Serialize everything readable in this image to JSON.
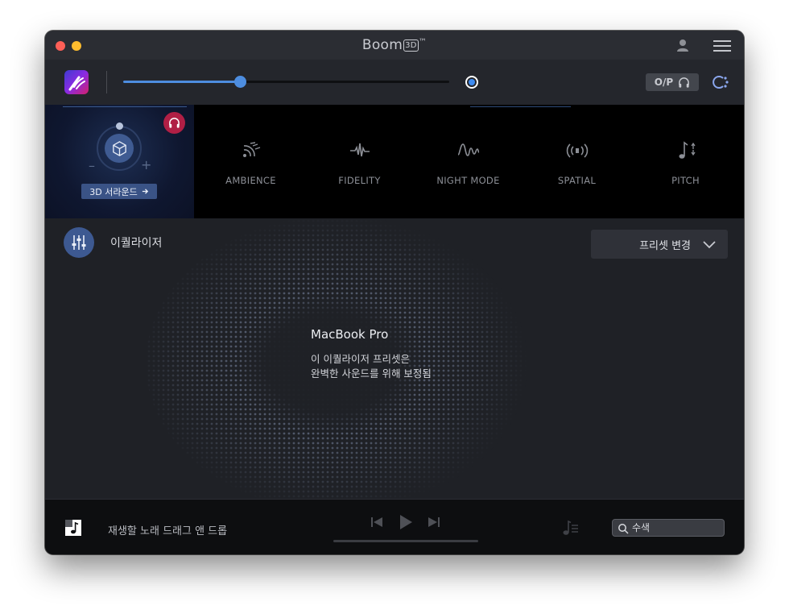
{
  "window": {
    "title": "Boom",
    "title_badge": "3D",
    "title_tm": "™"
  },
  "volume": {
    "level_fraction": 0.358,
    "op_label": "O/P"
  },
  "surround": {
    "button_label": "3D 서라운드",
    "minus": "–",
    "plus": "+"
  },
  "effects": [
    {
      "label": "AMBIENCE",
      "icon": "ambience-icon"
    },
    {
      "label": "FIDELITY",
      "icon": "fidelity-icon"
    },
    {
      "label": "NIGHT MODE",
      "icon": "night-mode-icon"
    },
    {
      "label": "SPATIAL",
      "icon": "spatial-icon"
    },
    {
      "label": "PITCH",
      "icon": "pitch-icon"
    }
  ],
  "equalizer": {
    "label": "이퀄라이저",
    "preset_button": "프리셋 변경",
    "device_name": "MacBook Pro",
    "device_desc_line1": "이 이퀄라이저 프리셋은",
    "device_desc_line2": "완벽한 사운드를 위해 보정됨"
  },
  "player": {
    "drag_hint": "재생할 노래 드래그 앤 드롭",
    "search_placeholder": "수색"
  },
  "colors": {
    "accent": "#4d8de0",
    "surround_badge": "#b01f45",
    "window_bg": "#1c1e24"
  }
}
